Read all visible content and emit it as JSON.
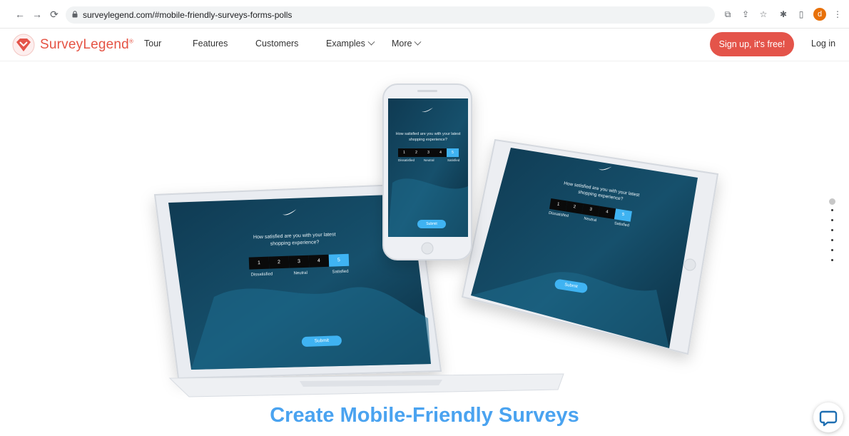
{
  "browser": {
    "url": "surveylegend.com/#mobile-friendly-surveys-forms-polls",
    "profile_initial": "d"
  },
  "site": {
    "brand": "SurveyLegend",
    "brand_mark": "®",
    "nav": [
      {
        "label": "Tour"
      },
      {
        "label": "Features"
      },
      {
        "label": "Customers"
      },
      {
        "label": "Examples"
      },
      {
        "label": "More"
      }
    ],
    "signup_label": "Sign up, it's free!",
    "login_label": "Log in"
  },
  "hero": {
    "title": "Create Mobile-Friendly Surveys",
    "survey": {
      "question_line1": "How satisfied are you with your latest",
      "question_line2": "shopping experience?",
      "scale": [
        "1",
        "2",
        "3",
        "4",
        "5"
      ],
      "left_label": "Dissatisfied",
      "mid_label": "Neutral",
      "right_label": "Satisfied",
      "selected": 5,
      "submit_label": "Submit"
    }
  },
  "colors": {
    "brand_red": "#e4544a",
    "title_blue": "#4aa3f0",
    "screen_bg": "#123c52",
    "accent_blue": "#3fb3f2"
  },
  "icons": {
    "back": "back-arrow-icon",
    "forward": "forward-arrow-icon",
    "reload": "reload-icon",
    "lock": "lock-icon",
    "translate": "translate-icon",
    "share": "share-icon",
    "star": "star-icon",
    "extensions": "puzzle-icon",
    "sidepanel": "side-panel-icon",
    "menu": "kebab-menu-icon",
    "chat": "chat-bubble-icon"
  }
}
